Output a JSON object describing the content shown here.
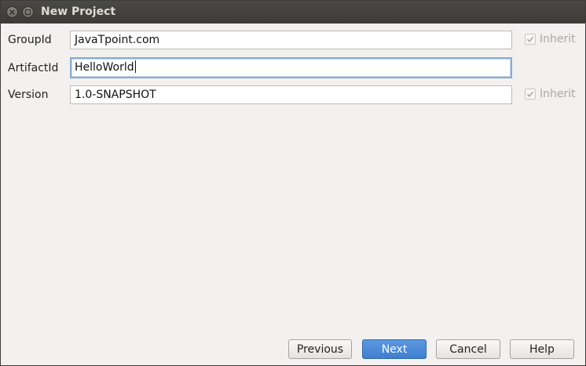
{
  "window": {
    "title": "New Project"
  },
  "form": {
    "group_id": {
      "label": "GroupId",
      "value": "JavaTpoint.com",
      "inherit_label": "Inherit",
      "inherit_checked": true
    },
    "artifact_id": {
      "label": "ArtifactId",
      "value": "HelloWorld"
    },
    "version": {
      "label": "Version",
      "value": "1.0-SNAPSHOT",
      "inherit_label": "Inherit",
      "inherit_checked": true
    }
  },
  "buttons": {
    "previous": "Previous",
    "next": "Next",
    "cancel": "Cancel",
    "help": "Help"
  },
  "colors": {
    "titlebar": "#3c3b37",
    "background": "#f2f1f0",
    "primary_button": "#4a88d6",
    "focus_border": "#8aa9d4"
  }
}
